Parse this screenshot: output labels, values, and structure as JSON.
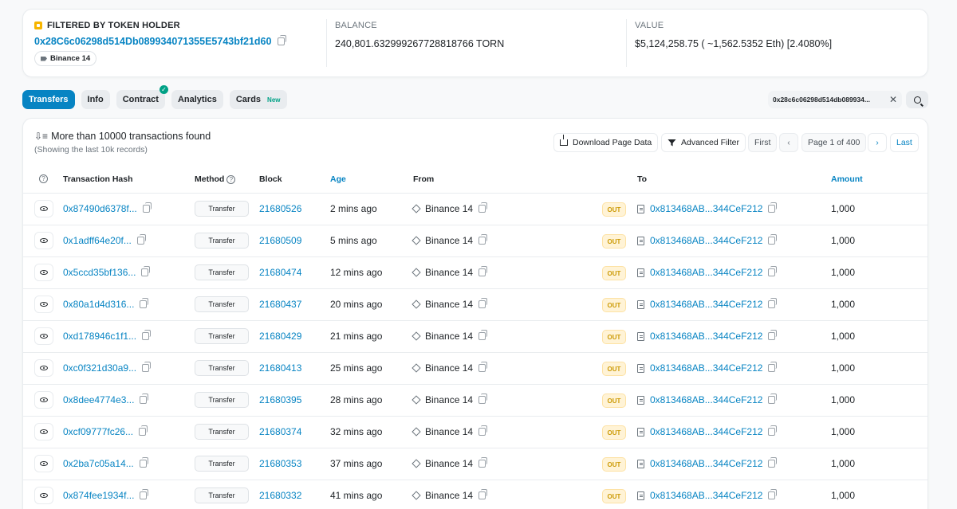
{
  "filter": {
    "label": "FILTERED BY TOKEN HOLDER",
    "address": "0x28C6c06298d514Db089934071355E5743bf21d60",
    "name_tag": "Binance 14",
    "balance_label": "BALANCE",
    "balance_value": "240,801.632999267728818766 TORN",
    "value_label": "VALUE",
    "value_value": "$5,124,258.75 ( ~1,562.5352 Eth) [2.4080%]"
  },
  "tabs": [
    {
      "label": "Transfers",
      "active": true
    },
    {
      "label": "Info"
    },
    {
      "label": "Contract",
      "verified": true
    },
    {
      "label": "Analytics"
    },
    {
      "label": "Cards",
      "badge": "New"
    }
  ],
  "address_filter": "0x28c6c06298d514db089934...",
  "summary": {
    "main": "More than 10000 transactions found",
    "sub": "(Showing the last 10k records)"
  },
  "toolbar": {
    "download": "Download Page Data",
    "advanced_filter": "Advanced Filter",
    "first": "First",
    "page": "Page 1 of 400",
    "last": "Last"
  },
  "columns": {
    "hash": "Transaction Hash",
    "method": "Method",
    "block": "Block",
    "age": "Age",
    "from": "From",
    "to": "To",
    "amount": "Amount"
  },
  "rows": [
    {
      "hash": "0x87490d6378f...",
      "method": "Transfer",
      "block": "21680526",
      "age": "2 mins ago",
      "from": "Binance 14",
      "dir": "OUT",
      "to": "0x813468AB...344CeF212",
      "amount": "1,000"
    },
    {
      "hash": "0x1adff64e20f...",
      "method": "Transfer",
      "block": "21680509",
      "age": "5 mins ago",
      "from": "Binance 14",
      "dir": "OUT",
      "to": "0x813468AB...344CeF212",
      "amount": "1,000"
    },
    {
      "hash": "0x5ccd35bf136...",
      "method": "Transfer",
      "block": "21680474",
      "age": "12 mins ago",
      "from": "Binance 14",
      "dir": "OUT",
      "to": "0x813468AB...344CeF212",
      "amount": "1,000"
    },
    {
      "hash": "0x80a1d4d316...",
      "method": "Transfer",
      "block": "21680437",
      "age": "20 mins ago",
      "from": "Binance 14",
      "dir": "OUT",
      "to": "0x813468AB...344CeF212",
      "amount": "1,000"
    },
    {
      "hash": "0xd178946c1f1...",
      "method": "Transfer",
      "block": "21680429",
      "age": "21 mins ago",
      "from": "Binance 14",
      "dir": "OUT",
      "to": "0x813468AB...344CeF212",
      "amount": "1,000"
    },
    {
      "hash": "0xc0f321d30a9...",
      "method": "Transfer",
      "block": "21680413",
      "age": "25 mins ago",
      "from": "Binance 14",
      "dir": "OUT",
      "to": "0x813468AB...344CeF212",
      "amount": "1,000"
    },
    {
      "hash": "0x8dee4774e3...",
      "method": "Transfer",
      "block": "21680395",
      "age": "28 mins ago",
      "from": "Binance 14",
      "dir": "OUT",
      "to": "0x813468AB...344CeF212",
      "amount": "1,000"
    },
    {
      "hash": "0xcf09777fc26...",
      "method": "Transfer",
      "block": "21680374",
      "age": "32 mins ago",
      "from": "Binance 14",
      "dir": "OUT",
      "to": "0x813468AB...344CeF212",
      "amount": "1,000"
    },
    {
      "hash": "0x2ba7c05a14...",
      "method": "Transfer",
      "block": "21680353",
      "age": "37 mins ago",
      "from": "Binance 14",
      "dir": "OUT",
      "to": "0x813468AB...344CeF212",
      "amount": "1,000"
    },
    {
      "hash": "0x874fee1934f...",
      "method": "Transfer",
      "block": "21680332",
      "age": "41 mins ago",
      "from": "Binance 14",
      "dir": "OUT",
      "to": "0x813468AB...344CeF212",
      "amount": "1,000"
    }
  ]
}
